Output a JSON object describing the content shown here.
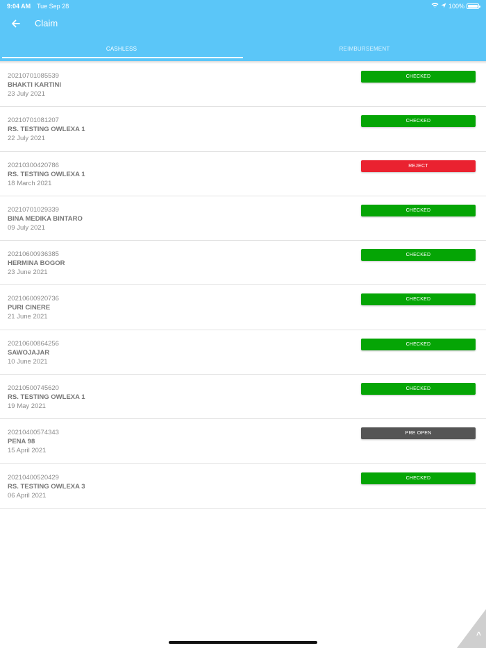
{
  "status_bar": {
    "time": "9:04 AM",
    "date": "Tue Sep 28",
    "battery": "100%"
  },
  "header": {
    "title": "Claim",
    "tabs": [
      {
        "label": "CASHLESS",
        "active": true
      },
      {
        "label": "REIMBURSEMENT",
        "active": false
      }
    ]
  },
  "colors": {
    "header": "#5bc6f8",
    "checked": "#05a505",
    "reject": "#ea2230",
    "pre_open": "#555555"
  },
  "claims": [
    {
      "number": "20210701085539",
      "provider": "BHAKTI KARTINI",
      "date": "23 July 2021",
      "status": "CHECKED",
      "color": "#05a505"
    },
    {
      "number": "20210701081207",
      "provider": "RS. TESTING OWLEXA 1",
      "date": "22 July 2021",
      "status": "CHECKED",
      "color": "#05a505"
    },
    {
      "number": "20210300420786",
      "provider": "RS. TESTING OWLEXA 1",
      "date": "18 March 2021",
      "status": "REJECT",
      "color": "#ea2230"
    },
    {
      "number": "20210701029339",
      "provider": "BINA MEDIKA BINTARO",
      "date": "09 July 2021",
      "status": "CHECKED",
      "color": "#05a505"
    },
    {
      "number": "20210600936385",
      "provider": "HERMINA BOGOR",
      "date": "23 June 2021",
      "status": "CHECKED",
      "color": "#05a505"
    },
    {
      "number": "20210600920736",
      "provider": "PURI CINERE",
      "date": "21 June 2021",
      "status": "CHECKED",
      "color": "#05a505"
    },
    {
      "number": "20210600864256",
      "provider": "SAWOJAJAR",
      "date": "10 June 2021",
      "status": "CHECKED",
      "color": "#05a505"
    },
    {
      "number": "20210500745620",
      "provider": "RS. TESTING OWLEXA 1",
      "date": "19 May 2021",
      "status": "CHECKED",
      "color": "#05a505"
    },
    {
      "number": "20210400574343",
      "provider": "PENA 98",
      "date": "15 April 2021",
      "status": "PRE OPEN",
      "color": "#555555"
    },
    {
      "number": "20210400520429",
      "provider": "RS. TESTING OWLEXA 3",
      "date": "06 April 2021",
      "status": "CHECKED",
      "color": "#05a505"
    }
  ],
  "icons": {
    "back": "arrow-left-icon",
    "scroll_top": "caret-up-icon"
  },
  "scroll_top_glyph": "^"
}
